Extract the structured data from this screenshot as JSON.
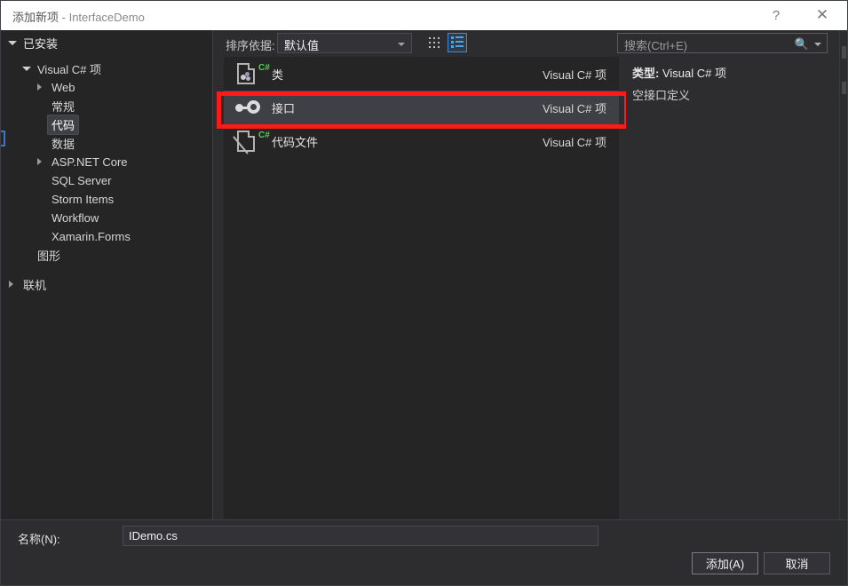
{
  "titlebar": {
    "title": "添加新项",
    "separator": " - ",
    "project": "InterfaceDemo",
    "help_label": "?",
    "close_label": "✕"
  },
  "sidebar": {
    "header": "已安装",
    "items": [
      {
        "label": "Visual C# 项",
        "indent": 1,
        "expander": "down",
        "selected": false
      },
      {
        "label": "Web",
        "indent": 2,
        "expander": "right",
        "selected": false
      },
      {
        "label": "常规",
        "indent": 2,
        "expander": "none",
        "selected": false
      },
      {
        "label": "代码",
        "indent": 2,
        "expander": "none",
        "selected": true
      },
      {
        "label": "数据",
        "indent": 2,
        "expander": "none",
        "selected": false
      },
      {
        "label": "ASP.NET Core",
        "indent": 2,
        "expander": "right",
        "selected": false
      },
      {
        "label": "SQL Server",
        "indent": 2,
        "expander": "none",
        "selected": false
      },
      {
        "label": "Storm Items",
        "indent": 2,
        "expander": "none",
        "selected": false
      },
      {
        "label": "Workflow",
        "indent": 2,
        "expander": "none",
        "selected": false
      },
      {
        "label": "Xamarin.Forms",
        "indent": 2,
        "expander": "none",
        "selected": false
      },
      {
        "label": "图形",
        "indent": 1,
        "expander": "none",
        "selected": false
      },
      {
        "label": "",
        "indent": 1,
        "expander": "none",
        "selected": false
      },
      {
        "label": "联机",
        "indent": 0,
        "expander": "right",
        "selected": false
      }
    ]
  },
  "toolbar": {
    "sort_label": "排序依据:",
    "sort_value": "默认值",
    "grid_view_icon": "grid-view-icon",
    "list_view_icon": "list-view-icon"
  },
  "search": {
    "placeholder": "搜索(Ctrl+E)",
    "icon": "search-icon"
  },
  "list": {
    "type_column": "Visual C# 项",
    "rows": [
      {
        "label": "类",
        "type": "Visual C# 项",
        "icon": "csharp-class-file-icon",
        "selected": false
      },
      {
        "label": "接口",
        "type": "Visual C# 项",
        "icon": "interface-lollipop-icon",
        "selected": true
      },
      {
        "label": "代码文件",
        "type": "Visual C# 项",
        "icon": "csharp-code-file-icon",
        "selected": false
      }
    ]
  },
  "details": {
    "type_label": "类型:",
    "type_value": "Visual C# 项",
    "description": "空接口定义"
  },
  "bottom": {
    "name_label": "名称(N):",
    "name_value": "IDemo.cs",
    "add_label": "添加(A)",
    "cancel_label": "取消"
  },
  "annotation": {
    "highlight_color": "#ff1a1a",
    "target": "接口"
  },
  "colors": {
    "dialog_bg": "#2d2d30",
    "panel_bg": "#252526",
    "selection_bg": "#3f3f46",
    "accent_blue": "#3c8ddc",
    "csharp_green": "#63c463"
  }
}
